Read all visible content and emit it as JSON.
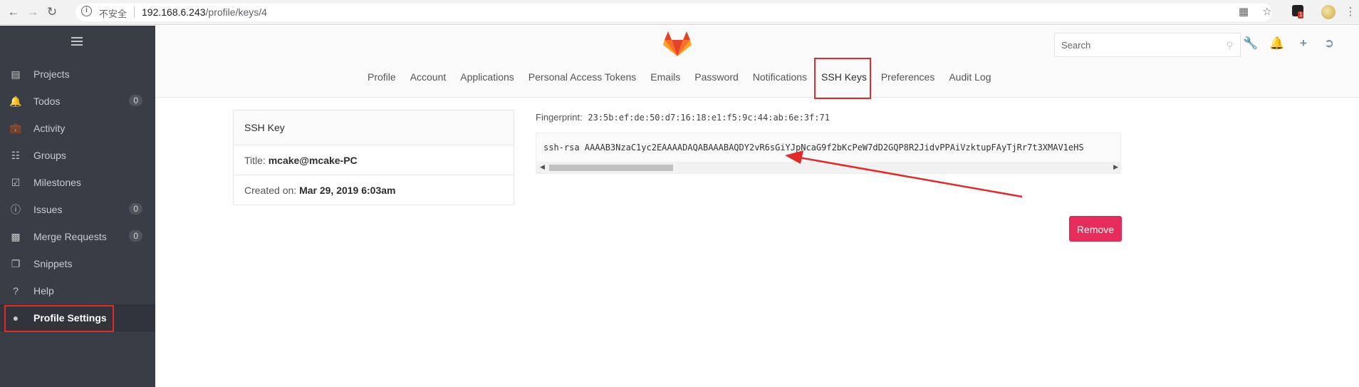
{
  "browser": {
    "insecure_label": "不安全",
    "url_host": "192.168.6.243",
    "url_path": "/profile/keys/4",
    "ext_badge": "1"
  },
  "sidebar": {
    "items": [
      {
        "label": "Projects",
        "icon": "projects-icon",
        "count": ""
      },
      {
        "label": "Todos",
        "icon": "bell-icon",
        "count": "0"
      },
      {
        "label": "Activity",
        "icon": "briefcase-icon",
        "count": ""
      },
      {
        "label": "Groups",
        "icon": "sitemap-icon",
        "count": ""
      },
      {
        "label": "Milestones",
        "icon": "calendar-check-icon",
        "count": ""
      },
      {
        "label": "Issues",
        "icon": "exclamation-circle-icon",
        "count": "0"
      },
      {
        "label": "Merge Requests",
        "icon": "terminal-icon",
        "count": "0"
      },
      {
        "label": "Snippets",
        "icon": "copy-icon",
        "count": ""
      },
      {
        "label": "Help",
        "icon": "question-circle-icon",
        "count": ""
      },
      {
        "label": "Profile Settings",
        "icon": "user-icon",
        "count": "",
        "active": true
      }
    ]
  },
  "header": {
    "search_placeholder": "Search",
    "tabs": [
      {
        "label": "Profile"
      },
      {
        "label": "Account"
      },
      {
        "label": "Applications"
      },
      {
        "label": "Personal Access Tokens"
      },
      {
        "label": "Emails"
      },
      {
        "label": "Password"
      },
      {
        "label": "Notifications"
      },
      {
        "label": "SSH Keys",
        "active": true
      },
      {
        "label": "Preferences"
      },
      {
        "label": "Audit Log"
      }
    ]
  },
  "key_card": {
    "heading": "SSH Key",
    "title_label": "Title:",
    "title_value": "mcake@mcake-PC",
    "created_label": "Created on:",
    "created_value": "Mar 29, 2019 6:03am"
  },
  "fingerprint": {
    "label": "Fingerprint:",
    "value": "23:5b:ef:de:50:d7:16:18:e1:f5:9c:44:ab:6e:3f:71"
  },
  "key_text": "ssh-rsa AAAAB3NzaC1yc2EAAAADAQABAAABAQDY2vR6sGiYJpNcaG9f2bKcPeW7dD2GQP8R2JidvPPAiVzktupFAyTjRr7t3XMAV1eHS",
  "actions": {
    "remove_label": "Remove"
  },
  "colors": {
    "sidebar_bg": "#393e46",
    "remove_bg": "#e52c5a",
    "highlight": "#e12a2a"
  }
}
